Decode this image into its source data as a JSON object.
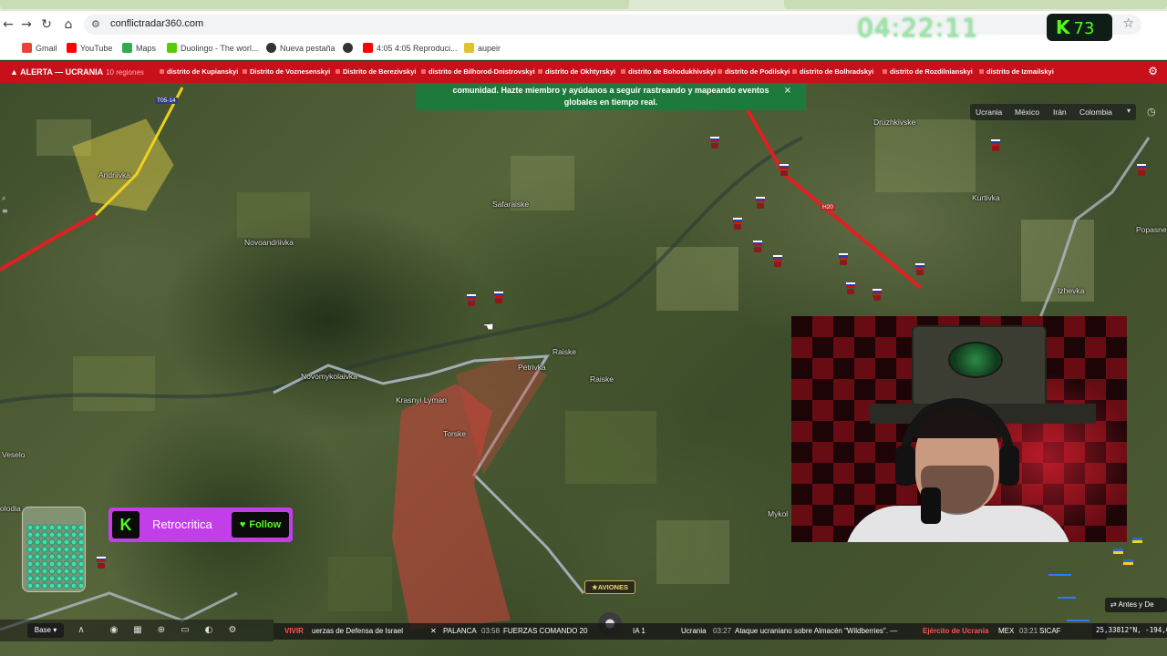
{
  "browser": {
    "url": "conflictradar360.com",
    "bookmarks": [
      {
        "label": "Gmail",
        "color": "#ea4335"
      },
      {
        "label": "YouTube",
        "color": "#ff0000"
      },
      {
        "label": "Maps",
        "color": "#34a853"
      },
      {
        "label": "Duolingo - The worl...",
        "color": "#58cc02"
      },
      {
        "label": "Nueva pestaña",
        "color": "#333333"
      },
      {
        "label": "",
        "color": "#333333"
      },
      {
        "label": "4:05 4:05 Reproduci...",
        "color": "#ff0000"
      },
      {
        "label": "aupeir",
        "color": "#e0c22a"
      }
    ]
  },
  "overlay": {
    "clock": "04:22:11",
    "kick_viewers": "73",
    "kick_letter": "K"
  },
  "alert": {
    "title": "ALERTA — UCRANIA",
    "count": "10 regiones",
    "districts": [
      "distrito de Kupianskyi",
      "Distrito de Voznesenskyi",
      "Distrito de Berezivskyi",
      "distrito de Bilhorod-Dnistrovskyi",
      "distrito de Okhtyrskyi",
      "distrito de Bohodukhivskyi",
      "distrito de Podilskyi",
      "distrito de Bolhradskyi",
      "distrito de Rozdilnianskyi",
      "distrito de Izmailskyi"
    ]
  },
  "notice": {
    "text_line1": "comunidad. Hazte miembro y ayúdanos a seguir rastreando y mapeando eventos",
    "text_line2": "globales en tiempo real.",
    "close": "×"
  },
  "country_tabs": [
    "Ucrania",
    "México",
    "Irán",
    "Colombia"
  ],
  "map": {
    "places": [
      {
        "name": "Andriivka"
      },
      {
        "name": "Novoandriivka"
      },
      {
        "name": "Safaraiske"
      },
      {
        "name": "Druzhkivske"
      },
      {
        "name": "Kurtivka"
      },
      {
        "name": "Novomykolaivka"
      },
      {
        "name": "Petrivka"
      },
      {
        "name": "Raiske"
      },
      {
        "name": "Raiske"
      },
      {
        "name": "Krasnyi Lyman"
      },
      {
        "name": "Torske"
      },
      {
        "name": "Izhevka"
      },
      {
        "name": "Popasne"
      },
      {
        "name": "Veselo"
      },
      {
        "name": "Mykol"
      },
      {
        "name": "olodia"
      }
    ],
    "road_signs": [
      "T05-14",
      "H20"
    ]
  },
  "kick_follow": {
    "streamer": "Retrocritica",
    "follow": "Follow",
    "logo": "K"
  },
  "bottom": {
    "base_label": "Base",
    "aviones": "★AVIONES",
    "antes": "Antes y De",
    "coords": "25,33812°N, -194,6",
    "ticker": [
      {
        "tag": "VIVIR",
        "text": "uerzas de Defensa de Israel"
      },
      {
        "tag": "✕",
        "text": "PALANCA"
      },
      {
        "time": "03:58",
        "text": "FUERZAS COMANDO 20"
      },
      {
        "text": "IA 1"
      },
      {
        "text": "Ucrania"
      },
      {
        "time": "03:27",
        "text": "Ataque ucraniano sobre Almacén \"Wildberries\". —"
      },
      {
        "text": "Ejército de Ucrania"
      },
      {
        "text": "MEX"
      },
      {
        "time": "03:21",
        "text": "SICAF"
      }
    ]
  }
}
